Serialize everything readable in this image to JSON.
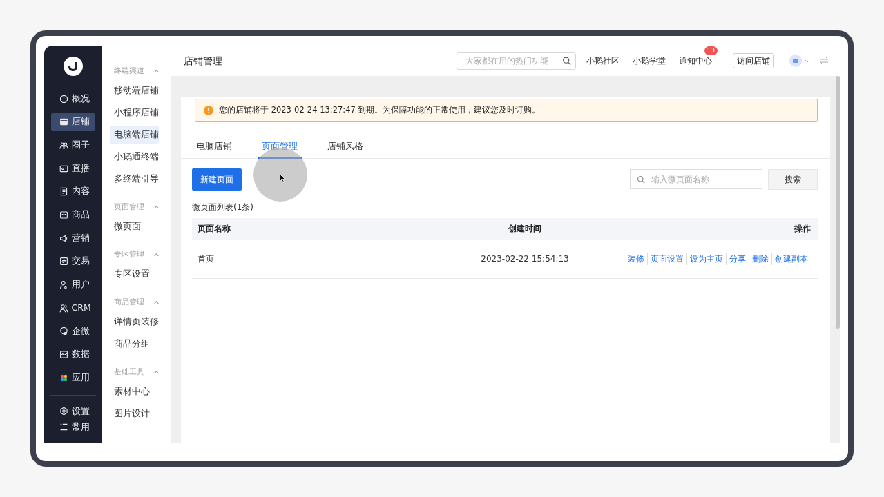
{
  "main_nav": {
    "items": [
      {
        "label": "概况",
        "selected": false
      },
      {
        "label": "店铺",
        "selected": true
      },
      {
        "label": "圈子",
        "selected": false
      },
      {
        "label": "直播",
        "selected": false
      },
      {
        "label": "内容",
        "selected": false
      },
      {
        "label": "商品",
        "selected": false
      },
      {
        "label": "营销",
        "selected": false
      },
      {
        "label": "交易",
        "selected": false
      },
      {
        "label": "用户",
        "selected": false
      },
      {
        "label": "CRM",
        "selected": false
      },
      {
        "label": "企微",
        "selected": false
      },
      {
        "label": "数据",
        "selected": false
      },
      {
        "label": "应用",
        "selected": false
      }
    ],
    "bottom_items": [
      {
        "label": "设置"
      },
      {
        "label": "常用"
      }
    ]
  },
  "sub_nav": {
    "groups": [
      {
        "title": "终端渠道",
        "expanded": true,
        "items": [
          {
            "label": "移动端店铺",
            "selected": false
          },
          {
            "label": "小程序店铺",
            "selected": false
          },
          {
            "label": "电脑端店铺",
            "selected": true
          },
          {
            "label": "小鹅通终端",
            "selected": false
          },
          {
            "label": "多终端引导",
            "selected": false
          }
        ]
      },
      {
        "title": "页面管理",
        "expanded": true,
        "items": [
          {
            "label": "微页面",
            "selected": false
          }
        ]
      },
      {
        "title": "专区管理",
        "expanded": true,
        "items": [
          {
            "label": "专区设置",
            "selected": false
          }
        ]
      },
      {
        "title": "商品管理",
        "expanded": true,
        "items": [
          {
            "label": "详情页装修",
            "selected": false
          },
          {
            "label": "商品分组",
            "selected": false
          }
        ]
      },
      {
        "title": "基础工具",
        "expanded": true,
        "items": [
          {
            "label": "素材中心",
            "selected": false
          },
          {
            "label": "图片设计",
            "selected": false
          }
        ]
      }
    ]
  },
  "header": {
    "title": "店铺管理",
    "search": {
      "placeholder": "大家都在用的热门功能"
    },
    "links": [
      "小鹅社区",
      "小鹅学堂"
    ],
    "notification": {
      "label": "通知中心",
      "badge": "13"
    },
    "visit_button": "访问店铺"
  },
  "alert": {
    "text": "您的店铺将于 2023-02-24 13:27:47 到期。为保障功能的正常使用，建议您及时订购。"
  },
  "tabs": [
    {
      "label": "电脑店铺",
      "selected": false
    },
    {
      "label": "页面管理",
      "selected": true
    },
    {
      "label": "店铺风格",
      "selected": false
    }
  ],
  "toolbar": {
    "new_button": "新建页面",
    "search": {
      "placeholder": "输入微页面名称"
    },
    "search_button": "搜索"
  },
  "list_caption": "微页面列表(1条)",
  "table": {
    "columns": [
      "页面名称",
      "创建时间",
      "操作"
    ],
    "rows": [
      {
        "name": "首页",
        "created": "2023-02-22 15:54:13",
        "actions": [
          "装修",
          "页面设置",
          "设为主页",
          "分享",
          "删除",
          "创建副本"
        ]
      }
    ]
  }
}
